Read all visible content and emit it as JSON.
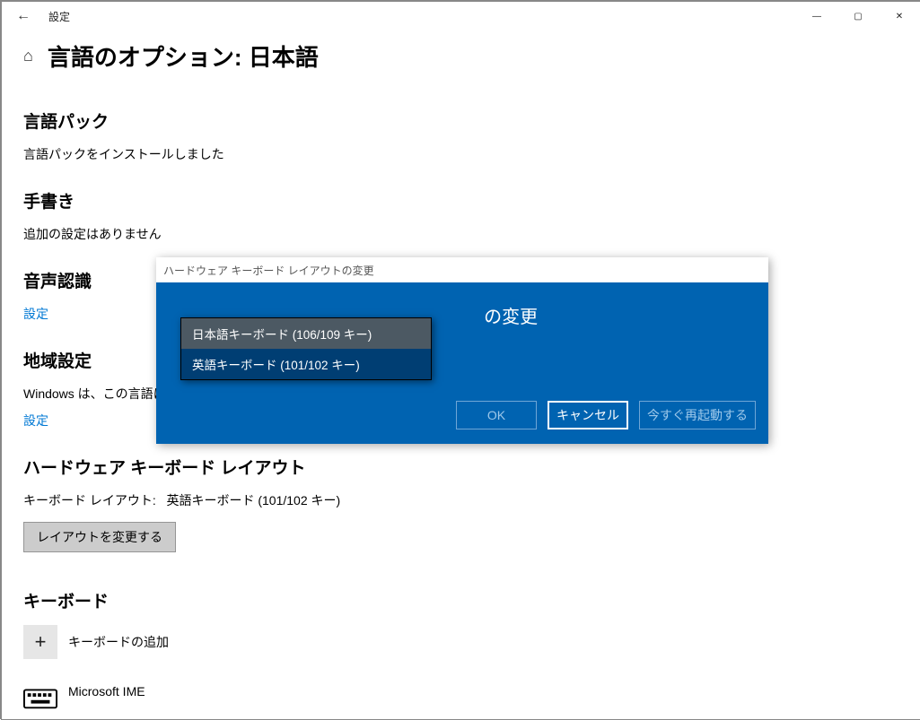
{
  "window": {
    "caption": "設定",
    "back_icon": "←",
    "min_icon": "—",
    "max_icon": "▢",
    "close_icon": "✕"
  },
  "page": {
    "home_icon": "⌂",
    "title": "言語のオプション: 日本語"
  },
  "sections": {
    "lang_pack": {
      "head": "言語パック",
      "body": "言語パックをインストールしました"
    },
    "handwriting": {
      "head": "手書き",
      "body": "追加の設定はありません"
    },
    "speech": {
      "head": "音声認識",
      "link": "設定"
    },
    "region": {
      "head": "地域設定",
      "body_truncated": "Windows は、この言語に基",
      "link": "設定"
    },
    "hw_kbd": {
      "head": "ハードウェア キーボード レイアウト",
      "label": "キーボード レイアウト:",
      "value": "英語キーボード (101/102 キー)",
      "button": "レイアウトを変更する"
    },
    "keyboards": {
      "head": "キーボード",
      "add_label": "キーボードの追加",
      "add_icon": "+",
      "ime_label": "Microsoft IME"
    }
  },
  "dialog": {
    "titlebar": "ハードウェア キーボード レイアウトの変更",
    "heading_suffix": "の変更",
    "options": [
      "日本語キーボード (106/109 キー)",
      "英語キーボード (101/102 キー)"
    ],
    "hover_index": 0,
    "buttons": {
      "ok": "OK",
      "cancel": "キャンセル",
      "restart": "今すぐ再起動する"
    }
  }
}
